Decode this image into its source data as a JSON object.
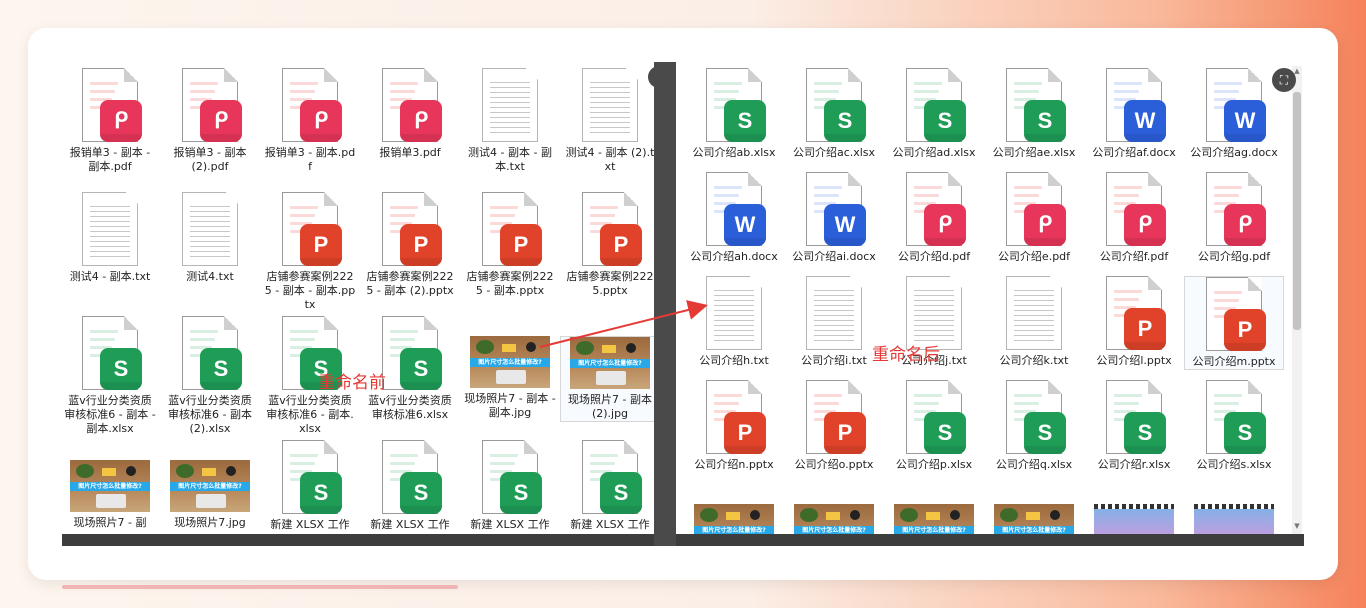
{
  "annotations": {
    "before": "重命名前",
    "after": "重命名后"
  },
  "icons": {
    "zoom": "zoom-fit-icon",
    "scroll_up": "chevron-up-icon",
    "scroll_down": "chevron-down-icon"
  },
  "colors": {
    "pdf": "#e8365a",
    "ppt": "#e0432a",
    "xls": "#1f9d57",
    "doc": "#2b5fd9",
    "annotation": "#e53935"
  },
  "left_files": [
    {
      "label": "报销单3 - 副本 - 副本.pdf",
      "type": "pdf",
      "badge": "ᑭ"
    },
    {
      "label": "报销单3 - 副本 (2).pdf",
      "type": "pdf",
      "badge": "ᑭ"
    },
    {
      "label": "报销单3 - 副本.pdf",
      "type": "pdf",
      "badge": "ᑭ"
    },
    {
      "label": "报销单3.pdf",
      "type": "pdf",
      "badge": "ᑭ"
    },
    {
      "label": "测试4 - 副本 - 副本.txt",
      "type": "txt"
    },
    {
      "label": "测试4 - 副本 (2).txt",
      "type": "txt"
    },
    {
      "label": "测试4 - 副本.txt",
      "type": "txt"
    },
    {
      "label": "测试4.txt",
      "type": "txt"
    },
    {
      "label": "店铺参赛案例2225 - 副本 - 副本.pptx",
      "type": "ppt",
      "badge": "P"
    },
    {
      "label": "店铺参赛案例2225 - 副本 (2).pptx",
      "type": "ppt",
      "badge": "P"
    },
    {
      "label": "店铺参赛案例2225 - 副本.pptx",
      "type": "ppt",
      "badge": "P"
    },
    {
      "label": "店铺参赛案例2225.pptx",
      "type": "ppt",
      "badge": "P"
    },
    {
      "label": "蓝v行业分类资质审核标准6 - 副本 - 副本.xlsx",
      "type": "xls",
      "badge": "S"
    },
    {
      "label": "蓝v行业分类资质审核标准6 - 副本 (2).xlsx",
      "type": "xls",
      "badge": "S"
    },
    {
      "label": "蓝v行业分类资质审核标准6 - 副本.xlsx",
      "type": "xls",
      "badge": "S"
    },
    {
      "label": "蓝v行业分类资质审核标准6.xlsx",
      "type": "xls",
      "badge": "S"
    },
    {
      "label": "现场照片7 - 副本 - 副本.jpg",
      "type": "photo"
    },
    {
      "label": "现场照片7 - 副本 (2).jpg",
      "type": "photo"
    },
    {
      "label": "现场照片7 - 副",
      "type": "photo"
    },
    {
      "label": "现场照片7.jpg",
      "type": "photo"
    },
    {
      "label": "新建 XLSX 工作",
      "type": "xls",
      "badge": "S"
    },
    {
      "label": "新建 XLSX 工作",
      "type": "xls",
      "badge": "S"
    },
    {
      "label": "新建 XLSX 工作",
      "type": "xls",
      "badge": "S"
    },
    {
      "label": "新建 XLSX 工作",
      "type": "xls",
      "badge": "S"
    }
  ],
  "right_files": [
    {
      "label": "公司介绍ab.xlsx",
      "type": "xls",
      "badge": "S"
    },
    {
      "label": "公司介绍ac.xlsx",
      "type": "xls",
      "badge": "S"
    },
    {
      "label": "公司介绍ad.xlsx",
      "type": "xls",
      "badge": "S"
    },
    {
      "label": "公司介绍ae.xlsx",
      "type": "xls",
      "badge": "S"
    },
    {
      "label": "公司介绍af.docx",
      "type": "doc",
      "badge": "W"
    },
    {
      "label": "公司介绍ag.docx",
      "type": "doc",
      "badge": "W"
    },
    {
      "label": "公司介绍ah.docx",
      "type": "doc",
      "badge": "W"
    },
    {
      "label": "公司介绍ai.docx",
      "type": "doc",
      "badge": "W"
    },
    {
      "label": "公司介绍d.pdf",
      "type": "pdf",
      "badge": "ᑭ"
    },
    {
      "label": "公司介绍e.pdf",
      "type": "pdf",
      "badge": "ᑭ"
    },
    {
      "label": "公司介绍f.pdf",
      "type": "pdf",
      "badge": "ᑭ"
    },
    {
      "label": "公司介绍g.pdf",
      "type": "pdf",
      "badge": "ᑭ"
    },
    {
      "label": "公司介绍h.txt",
      "type": "txt"
    },
    {
      "label": "公司介绍i.txt",
      "type": "txt"
    },
    {
      "label": "公司介绍j.txt",
      "type": "txt"
    },
    {
      "label": "公司介绍k.txt",
      "type": "txt"
    },
    {
      "label": "公司介绍l.pptx",
      "type": "ppt",
      "badge": "P"
    },
    {
      "label": "公司介绍m.pptx",
      "type": "ppt",
      "badge": "P"
    },
    {
      "label": "公司介绍n.pptx",
      "type": "ppt",
      "badge": "P"
    },
    {
      "label": "公司介绍o.pptx",
      "type": "ppt",
      "badge": "P"
    },
    {
      "label": "公司介绍p.xlsx",
      "type": "xls",
      "badge": "S"
    },
    {
      "label": "公司介绍q.xlsx",
      "type": "xls",
      "badge": "S"
    },
    {
      "label": "公司介绍r.xlsx",
      "type": "xls",
      "badge": "S"
    },
    {
      "label": "公司介绍s.xlsx",
      "type": "xls",
      "badge": "S"
    },
    {
      "label": "",
      "type": "photo"
    },
    {
      "label": "",
      "type": "photo"
    },
    {
      "label": "",
      "type": "photo"
    },
    {
      "label": "",
      "type": "photo"
    },
    {
      "label": "",
      "type": "video"
    },
    {
      "label": "",
      "type": "video"
    }
  ],
  "photo_band_text": "图片尺寸怎么批量修改?"
}
